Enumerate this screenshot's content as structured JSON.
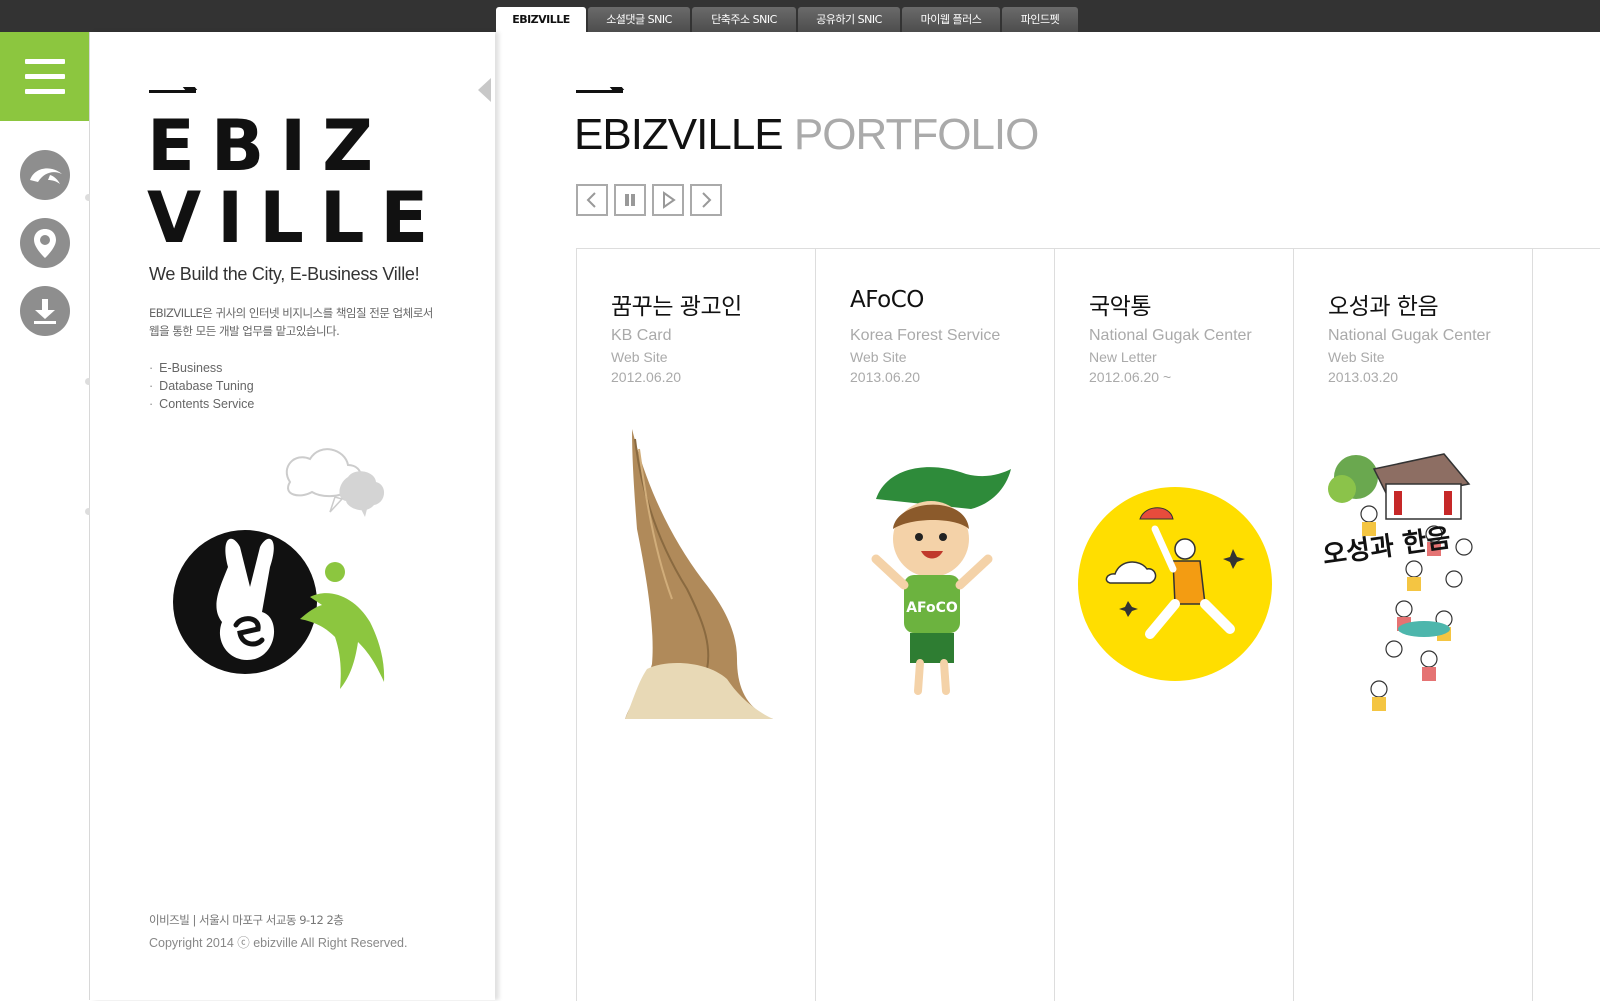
{
  "tabs": [
    {
      "label": "EBIZVILLE",
      "active": true
    },
    {
      "label": "소셜댓글 SNIC",
      "active": false
    },
    {
      "label": "단축주소 SNIC",
      "active": false
    },
    {
      "label": "공유하기 SNIC",
      "active": false
    },
    {
      "label": "마이웹 플러스",
      "active": false
    },
    {
      "label": "파인드펫",
      "active": false
    }
  ],
  "rail": {
    "icons": [
      "bird-icon",
      "location-pin-icon",
      "download-icon"
    ],
    "accent_color": "#8cc63f"
  },
  "info": {
    "logo_line1": "EBIZ",
    "logo_line2": "VILLE",
    "tagline": "We Build the City, E-Business Ville!",
    "desc_line1": "EBIZVILLE은 귀사의 인터넷 비지니스를 책임질 전문 업체로서",
    "desc_line2": "웹을 통한 모든 개발 업무를 맡고있습니다.",
    "services": [
      "E-Business",
      "Database Tuning",
      "Contents Service"
    ],
    "footer_address": "이비즈빌 | 서울시 마포구 서교동 9-12 2층",
    "footer_copyright": "Copyright 2014 ⓒ ebizville All Right Reserved."
  },
  "main": {
    "title_a": "EBIZVILLE",
    "title_b": "PORTFOLIO",
    "controls": [
      "prev-icon",
      "pause-icon",
      "play-icon",
      "next-icon"
    ]
  },
  "cards": [
    {
      "title": "꿈꾸는 광고인",
      "client": "KB Card",
      "type": "Web Site",
      "date": "2012.06.20"
    },
    {
      "title": "AFoCO",
      "client": "Korea Forest Service",
      "type": "Web Site",
      "date": "2013.06.20"
    },
    {
      "title": "국악통",
      "client": "National Gugak Center",
      "type": "New Letter",
      "date": "2012.06.20 ~"
    },
    {
      "title": "오성과 한음",
      "client": "National Gugak Center",
      "type": "Web Site",
      "date": "2013.03.20"
    }
  ],
  "afoco_badge": "AFoCO",
  "oseong_calligraphy": "오성과 한음"
}
